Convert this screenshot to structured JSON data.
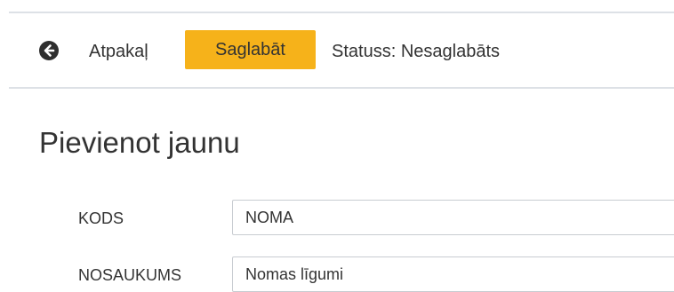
{
  "toolbar": {
    "back_icon": "arrow-left-circle-icon",
    "back_label": "Atpakaļ",
    "save_label": "Saglabāt",
    "status_text": "Statuss: Nesaglabāts",
    "save_color": "#f6b21a"
  },
  "page": {
    "title": "Pievienot jaunu"
  },
  "form": {
    "code_label": "KODS",
    "code_value": "NOMA",
    "name_label": "NOSAUKUMS",
    "name_value": "Nomas līgumi"
  }
}
